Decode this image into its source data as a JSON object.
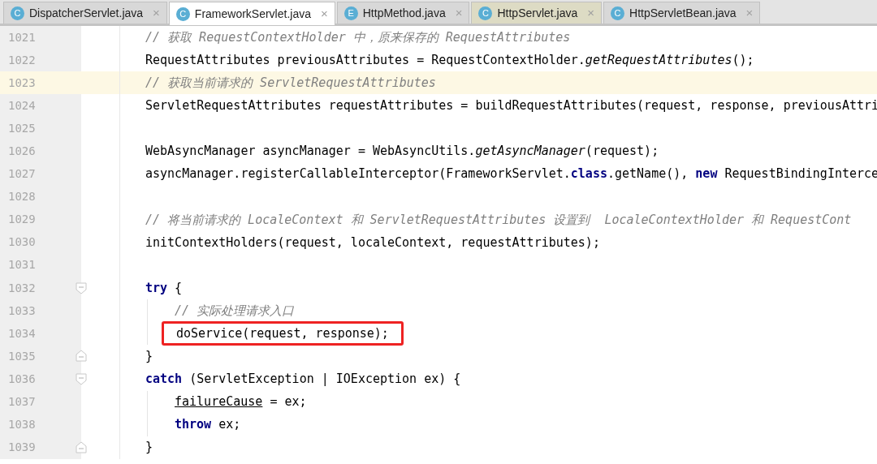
{
  "tabs": [
    {
      "icon": "C",
      "label": "DispatcherServlet.java",
      "close": "×",
      "selected": false,
      "highlighted": false
    },
    {
      "icon": "C",
      "label": "FrameworkServlet.java",
      "close": "×",
      "selected": true,
      "highlighted": false
    },
    {
      "icon": "E",
      "label": "HttpMethod.java",
      "close": "×",
      "selected": false,
      "highlighted": false
    },
    {
      "icon": "C",
      "label": "HttpServlet.java",
      "close": "×",
      "selected": false,
      "highlighted": true
    },
    {
      "icon": "C",
      "label": "HttpServletBean.java",
      "close": "×",
      "selected": false,
      "highlighted": false
    }
  ],
  "lines": [
    {
      "number": "1021",
      "current": false,
      "nested": false,
      "boxed": false,
      "segments": [
        {
          "kind": "comment",
          "text": "// 获取 RequestContextHolder 中，原来保存的 RequestAttributes"
        }
      ]
    },
    {
      "number": "1022",
      "current": false,
      "nested": false,
      "boxed": false,
      "segments": [
        {
          "kind": "plain",
          "text": "RequestAttributes previousAttributes = RequestContextHolder."
        },
        {
          "kind": "static",
          "text": "getRequestAttributes"
        },
        {
          "kind": "plain",
          "text": "();"
        }
      ]
    },
    {
      "number": "1023",
      "current": true,
      "nested": false,
      "boxed": false,
      "segments": [
        {
          "kind": "comment",
          "text": "// 获取当前请求的 ServletRequestAttributes"
        }
      ]
    },
    {
      "number": "1024",
      "current": false,
      "nested": false,
      "boxed": false,
      "segments": [
        {
          "kind": "plain",
          "text": "ServletRequestAttributes requestAttributes = buildRequestAttributes(request, response, previousAttri"
        }
      ]
    },
    {
      "number": "1025",
      "current": false
    },
    {
      "number": "1026",
      "current": false,
      "nested": false,
      "boxed": false,
      "segments": [
        {
          "kind": "plain",
          "text": "WebAsyncManager asyncManager = WebAsyncUtils."
        },
        {
          "kind": "static",
          "text": "getAsyncManager"
        },
        {
          "kind": "plain",
          "text": "(request);"
        }
      ]
    },
    {
      "number": "1027",
      "current": false,
      "nested": false,
      "boxed": false,
      "segments": [
        {
          "kind": "plain",
          "text": "asyncManager.registerCallableInterceptor(FrameworkServlet."
        },
        {
          "kind": "keyword",
          "text": "class"
        },
        {
          "kind": "plain",
          "text": ".getName(), "
        },
        {
          "kind": "keyword",
          "text": "new"
        },
        {
          "kind": "plain",
          "text": " RequestBindingInterce"
        }
      ]
    },
    {
      "number": "1028",
      "current": false
    },
    {
      "number": "1029",
      "current": false,
      "nested": false,
      "boxed": false,
      "segments": [
        {
          "kind": "comment",
          "text": "// 将当前请求的 LocaleContext 和 ServletRequestAttributes 设置到  LocaleContextHolder 和 RequestCont"
        }
      ]
    },
    {
      "number": "1030",
      "current": false,
      "nested": false,
      "boxed": false,
      "segments": [
        {
          "kind": "plain",
          "text": "initContextHolders(request, localeContext, requestAttributes);"
        }
      ]
    },
    {
      "number": "1031",
      "current": false
    },
    {
      "number": "1032",
      "current": false,
      "nested": false,
      "boxed": false,
      "fold": {
        "kind": "start"
      },
      "segments": [
        {
          "kind": "keyword",
          "text": "try"
        },
        {
          "kind": "plain",
          "text": " {"
        }
      ]
    },
    {
      "number": "1033",
      "current": false,
      "nested": true,
      "boxed": false,
      "segments": [
        {
          "kind": "comment",
          "text": "// 实际处理请求入口"
        }
      ]
    },
    {
      "number": "1034",
      "current": false,
      "nested": true,
      "boxed": true,
      "segments": [
        {
          "kind": "plain",
          "text": "doService(request, response);"
        }
      ]
    },
    {
      "number": "1035",
      "current": false,
      "nested": false,
      "boxed": false,
      "fold": {
        "kind": "end"
      },
      "segments": [
        {
          "kind": "plain",
          "text": "}"
        }
      ]
    },
    {
      "number": "1036",
      "current": false,
      "nested": false,
      "boxed": false,
      "fold": {
        "kind": "start"
      },
      "segments": [
        {
          "kind": "keyword",
          "text": "catch"
        },
        {
          "kind": "plain",
          "text": " (ServletException | IOException ex) {"
        }
      ]
    },
    {
      "number": "1037",
      "current": false,
      "nested": true,
      "boxed": false,
      "segments": [
        {
          "kind": "field",
          "text": "failureCause"
        },
        {
          "kind": "plain",
          "text": " = ex;"
        }
      ]
    },
    {
      "number": "1038",
      "current": false,
      "nested": true,
      "boxed": false,
      "segments": [
        {
          "kind": "keyword",
          "text": "throw"
        },
        {
          "kind": "plain",
          "text": " ex;"
        }
      ]
    },
    {
      "number": "1039",
      "current": false,
      "nested": false,
      "boxed": false,
      "fold": {
        "kind": "end"
      },
      "segments": [
        {
          "kind": "plain",
          "text": "}"
        }
      ]
    }
  ]
}
